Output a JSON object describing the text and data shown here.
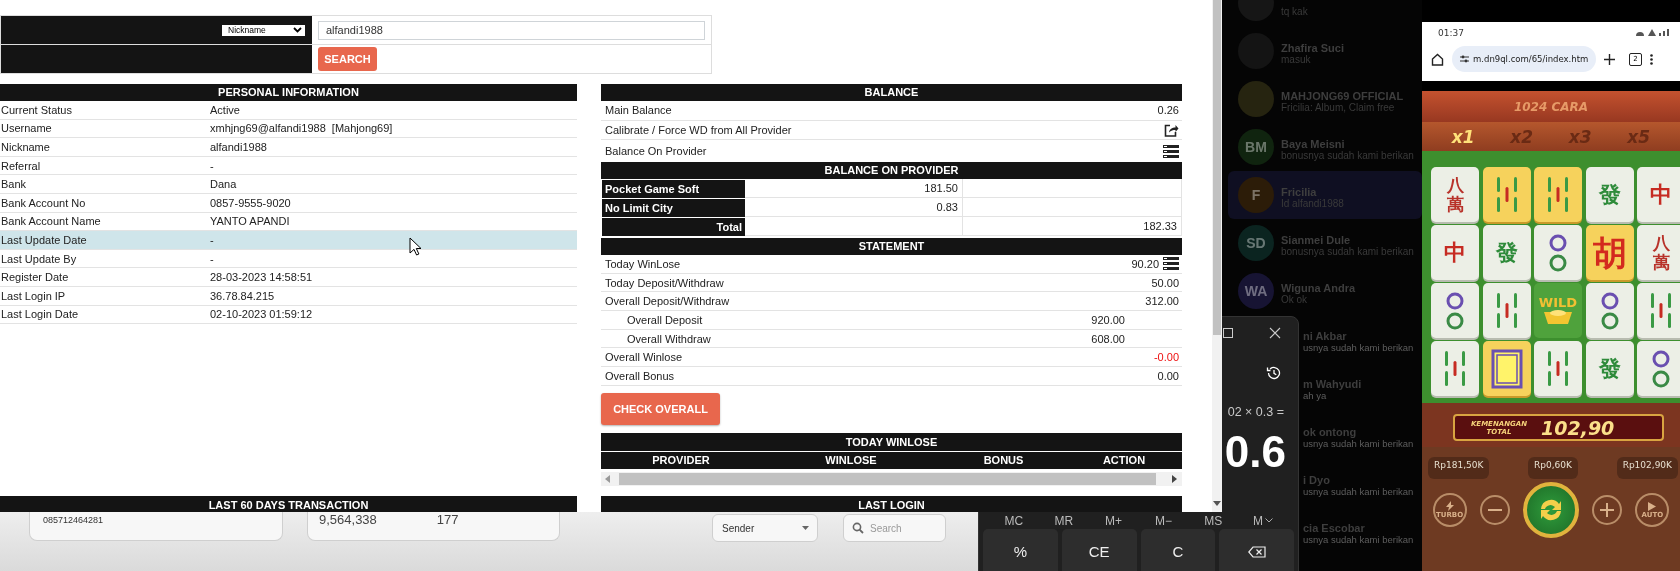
{
  "search_form": {
    "field_select": "Nickname",
    "value": "alfandi1988",
    "button": "SEARCH"
  },
  "personal_information": {
    "title": "PERSONAL INFORMATION",
    "rows": [
      {
        "label": "Current Status",
        "value": "Active",
        "highlighted": false
      },
      {
        "label": "Username",
        "value": "xmhjng69@alfandi1988  [Mahjong69]",
        "highlighted": false
      },
      {
        "label": "Nickname",
        "value": "alfandi1988",
        "highlighted": false
      },
      {
        "label": "Referral",
        "value": "-",
        "highlighted": false
      },
      {
        "label": "Bank",
        "value": "Dana",
        "highlighted": false
      },
      {
        "label": "Bank Account No",
        "value": "0857-9555-9020",
        "highlighted": false
      },
      {
        "label": "Bank Account Name",
        "value": "YANTO APANDI",
        "highlighted": false
      },
      {
        "label": "Last Update Date",
        "value": "-",
        "highlighted": true
      },
      {
        "label": "Last Update By",
        "value": "-",
        "highlighted": false
      },
      {
        "label": "Register Date",
        "value": "28-03-2023 14:58:51",
        "highlighted": false
      },
      {
        "label": "Last Login IP",
        "value": "36.78.84.215",
        "highlighted": false
      },
      {
        "label": "Last Login Date",
        "value": "02-10-2023 01:59:12",
        "highlighted": false
      }
    ]
  },
  "last_60_days_transaction": {
    "title": "LAST 60 DAYS TRANSACTION"
  },
  "balance": {
    "title": "BALANCE",
    "rows": [
      {
        "kind": "value",
        "label": "Main Balance",
        "value": "0.26"
      },
      {
        "kind": "share",
        "label": "Calibrate / Force WD from All Provider"
      },
      {
        "kind": "list",
        "label": "Balance On Provider"
      }
    ]
  },
  "balance_on_provider": {
    "title": "BALANCE ON PROVIDER",
    "rows": [
      {
        "name": "Pocket Game Soft",
        "amount": "181.50"
      },
      {
        "name": "No Limit City",
        "amount": "0.83"
      }
    ],
    "total": {
      "label": "Total",
      "amount": "182.33"
    }
  },
  "statement": {
    "title": "STATEMENT",
    "rows": [
      {
        "kind": "list",
        "label": "Today WinLose",
        "value": "90.20",
        "negative": false
      },
      {
        "kind": "main",
        "label": "Today Deposit/Withdraw",
        "value": "50.00",
        "negative": false
      },
      {
        "kind": "main",
        "label": "Overall Deposit/Withdraw",
        "value": "312.00",
        "negative": false
      },
      {
        "kind": "sub",
        "label": "Overall Deposit",
        "value": "920.00",
        "negative": false
      },
      {
        "kind": "sub",
        "label": "Overall Withdraw",
        "value": "608.00",
        "negative": false
      },
      {
        "kind": "main",
        "label": "Overall Winlose",
        "value": "-0.00",
        "negative": true
      },
      {
        "kind": "main",
        "label": "Overall Bonus",
        "value": "0.00",
        "negative": false
      }
    ]
  },
  "check_button": "CHECK OVERALL",
  "today_winlose": {
    "title": "TODAY WINLOSE",
    "columns": [
      "PROVIDER",
      "WINLOSE",
      "BONUS",
      "ACTION"
    ]
  },
  "last_login": {
    "title": "LAST LOGIN"
  },
  "background_page": {
    "phone_field": "085712464281",
    "amount": "9,564,338",
    "count": "177",
    "sender_select": "Sender",
    "search_placeholder": "Search"
  },
  "calculator": {
    "expression": "02 × 0.3 =",
    "result": "0.6",
    "memory_buttons": [
      {
        "label": "MC",
        "dropdown": false
      },
      {
        "label": "MR",
        "dropdown": false
      },
      {
        "label": "M+",
        "dropdown": false
      },
      {
        "label": "M−",
        "dropdown": false
      },
      {
        "label": "MS",
        "dropdown": false
      },
      {
        "label": "M",
        "dropdown": true
      }
    ],
    "keys": [
      "%",
      "CE",
      "C"
    ]
  },
  "chat_list": [
    {
      "kind": "full",
      "avatar": {
        "kind": "photo",
        "color": "#161616"
      },
      "message": "tq kak",
      "selected": false
    },
    {
      "kind": "full",
      "avatar": {
        "kind": "photo",
        "color": "#141414"
      },
      "name": "Zhafira Suci",
      "message": "masuk",
      "selected": false
    },
    {
      "kind": "full",
      "avatar": {
        "kind": "photo",
        "color": "#262410"
      },
      "name": "MAHJONG69 OFFICIAL",
      "message": "Fricilia: Album, Claim free",
      "selected": false
    },
    {
      "kind": "full",
      "avatar": {
        "kind": "initials",
        "initials": "BM",
        "color": "#10240f"
      },
      "name": "Baya Meisni",
      "message": "bonusnya sudah kami berikan",
      "selected": false
    },
    {
      "kind": "full",
      "avatar": {
        "kind": "initials",
        "initials": "F",
        "color": "#2c1c08"
      },
      "name": "Fricilia",
      "message": "Id alfandi1988",
      "selected": true
    },
    {
      "kind": "full",
      "avatar": {
        "kind": "initials",
        "initials": "SD",
        "color": "#0b2420"
      },
      "name": "Sianmei Dule",
      "message": "bonusnya sudah kami berikan",
      "selected": false
    },
    {
      "kind": "full",
      "avatar": {
        "kind": "initials",
        "initials": "WA",
        "color": "#171433"
      },
      "name": "Wiguna Andra",
      "message": "Ok ok",
      "selected": false
    },
    {
      "kind": "covered",
      "name": "ni Akbar",
      "message": "usnya sudah kami berikan",
      "selected": false
    },
    {
      "kind": "covered",
      "name": "m Wahyudi",
      "message": "ah ya",
      "selected": false
    },
    {
      "kind": "covered",
      "name": "ok ontong",
      "message": "usnya sudah kami berikan",
      "selected": false
    },
    {
      "kind": "covered",
      "name": "i Dyo",
      "message": "usnya sudah kami berikan",
      "selected": false
    },
    {
      "kind": "covered",
      "name": "cia Escobar",
      "message": "usnya sudah kami berikan",
      "selected": false
    }
  ],
  "phone": {
    "time": "01:37",
    "url": "m.dn9ql.com/65/index.htm",
    "tab_count": "2",
    "game": {
      "ways": "1024 CARA",
      "multipliers": [
        {
          "label": "x1",
          "selected": true
        },
        {
          "label": "x2",
          "selected": false
        },
        {
          "label": "x3",
          "selected": false
        },
        {
          "label": "x5",
          "selected": false
        }
      ],
      "tiles": [
        [
          {
            "kind": "char",
            "symbol": "八萬",
            "color": "#b8322a",
            "golden": false
          },
          {
            "kind": "bamboo",
            "golden": true
          },
          {
            "kind": "bamboo",
            "golden": true
          },
          {
            "kind": "char",
            "symbol": "發",
            "color": "#2e8b3a",
            "golden": false
          },
          {
            "kind": "char",
            "symbol": "中",
            "color": "#c62b22",
            "golden": false
          }
        ],
        [
          {
            "kind": "char",
            "symbol": "中",
            "color": "#c62b22",
            "golden": false
          },
          {
            "kind": "char",
            "symbol": "發",
            "color": "#2e8b3a",
            "golden": false
          },
          {
            "kind": "dots",
            "golden": false
          },
          {
            "kind": "hu",
            "symbol": "胡",
            "color": "#d32a1e",
            "golden": true
          },
          {
            "kind": "char",
            "symbol": "八萬",
            "color": "#b8322a",
            "golden": false
          }
        ],
        [
          {
            "kind": "dots",
            "golden": false
          },
          {
            "kind": "bamboo",
            "golden": false
          },
          {
            "kind": "wild",
            "symbol": "WILD",
            "color": "#f2c033",
            "golden": false
          },
          {
            "kind": "dots",
            "golden": false
          },
          {
            "kind": "bamboo",
            "golden": false
          }
        ],
        [
          {
            "kind": "bamboo",
            "golden": false
          },
          {
            "kind": "frame",
            "golden": true
          },
          {
            "kind": "bamboo",
            "golden": false
          },
          {
            "kind": "char",
            "symbol": "發",
            "color": "#2e8b3a",
            "golden": false
          },
          {
            "kind": "dots",
            "golden": false
          }
        ]
      ],
      "win_label": "KEMENANGAN TOTAL",
      "win_amount": "102,90",
      "balances": [
        "Rp181,50K",
        "Rp0,60K",
        "Rp102,90K"
      ],
      "turbo": "TURBO",
      "auto": "AUTO"
    }
  }
}
